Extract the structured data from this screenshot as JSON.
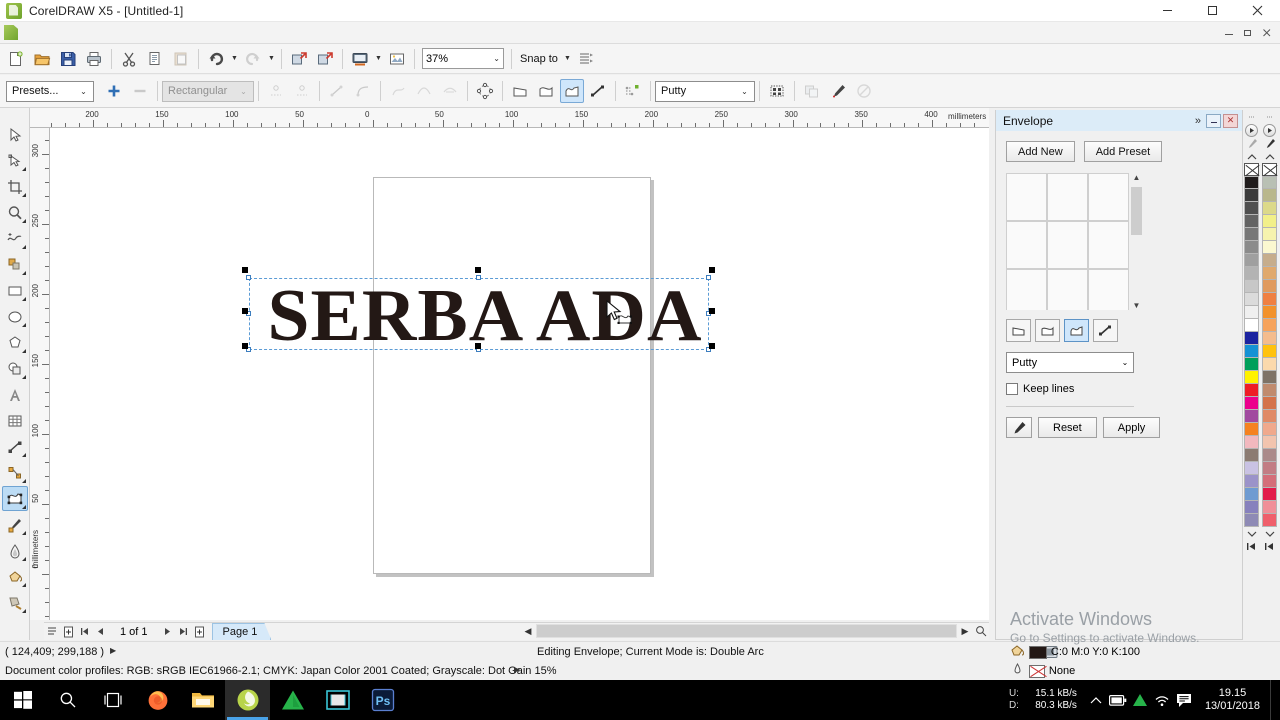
{
  "window": {
    "title": "CorelDRAW X5 - [Untitled-1]",
    "app_icon": "coreldraw-icon",
    "buttons": {
      "minimize": "minimize-icon",
      "maximize": "maximize-icon",
      "close": "close-icon"
    }
  },
  "doc_strip": {
    "icon": "document-icon",
    "buttons": [
      "minimize-icon",
      "restore-icon",
      "close-icon"
    ]
  },
  "toolbar": {
    "items": [
      {
        "name": "new-document-button",
        "icon": "new-icon"
      },
      {
        "name": "open-document-button",
        "icon": "folder-open-icon"
      },
      {
        "name": "save-document-button",
        "icon": "save-icon"
      },
      {
        "name": "print-button",
        "icon": "printer-icon"
      },
      {
        "name": "cut-button",
        "icon": "scissors-icon"
      },
      {
        "name": "copy-button",
        "icon": "copy-icon"
      },
      {
        "name": "paste-button",
        "icon": "paste-icon"
      },
      {
        "name": "undo-button",
        "icon": "undo-icon"
      },
      {
        "name": "redo-button",
        "icon": "redo-icon"
      },
      {
        "name": "import-button",
        "icon": "import-icon"
      },
      {
        "name": "export-button",
        "icon": "export-icon"
      },
      {
        "name": "application-launcher-button",
        "icon": "launcher-icon"
      },
      {
        "name": "corel-connect-button",
        "icon": "connect-icon"
      }
    ],
    "zoom_level": "37%",
    "snap_to_label": "Snap to",
    "options_icon": "options-icon"
  },
  "property_bar": {
    "presets_value": "Presets...",
    "add_preset_icon": "plus-icon",
    "remove_preset_icon": "minus-icon",
    "envelope_mode_value": "Rectangular",
    "mapping_mode_value": "Putty",
    "tools": [
      {
        "name": "add-node-button",
        "icon": "add-node-icon",
        "enabled": false
      },
      {
        "name": "delete-node-button",
        "icon": "delete-node-icon",
        "enabled": false
      },
      {
        "name": "convert-to-line-button",
        "icon": "to-line-icon",
        "enabled": false
      },
      {
        "name": "convert-to-curve-button",
        "icon": "to-curve-icon",
        "enabled": false
      },
      {
        "name": "cusp-node-button",
        "icon": "cusp-node-icon",
        "enabled": false
      },
      {
        "name": "smooth-node-button",
        "icon": "smooth-node-icon",
        "enabled": false
      },
      {
        "name": "symmetrical-node-button",
        "icon": "symmetrical-node-icon",
        "enabled": false
      },
      {
        "name": "envelope-straight-line-mode",
        "icon": "straight-line-envelope-icon",
        "enabled": true
      },
      {
        "name": "envelope-single-arc-mode",
        "icon": "single-arc-envelope-icon",
        "enabled": true
      },
      {
        "name": "envelope-double-arc-mode",
        "icon": "double-arc-envelope-icon",
        "enabled": true,
        "selected": true
      },
      {
        "name": "envelope-unconstrained-mode",
        "icon": "unconstrained-envelope-icon",
        "enabled": true
      },
      {
        "name": "add-new-envelope-button",
        "icon": "add-new-envelope-icon",
        "enabled": true
      },
      {
        "name": "create-envelope-from-button",
        "icon": "create-from-icon",
        "enabled": true
      },
      {
        "name": "keep-lines-button",
        "icon": "keep-lines-icon",
        "enabled": false
      },
      {
        "name": "copy-envelope-properties-button",
        "icon": "eyedropper-icon",
        "enabled": true
      },
      {
        "name": "clear-envelope-button",
        "icon": "clear-envelope-icon",
        "enabled": false
      }
    ]
  },
  "toolbox": {
    "tools": [
      {
        "name": "pick-tool",
        "icon": "arrow-cursor-icon",
        "flyout": false
      },
      {
        "name": "shape-tool",
        "icon": "shape-node-icon",
        "flyout": true
      },
      {
        "name": "crop-tool",
        "icon": "crop-icon",
        "flyout": true
      },
      {
        "name": "zoom-tool",
        "icon": "magnifier-icon",
        "flyout": true
      },
      {
        "name": "freehand-tool",
        "icon": "freehand-curve-icon",
        "flyout": true
      },
      {
        "name": "smart-fill-tool",
        "icon": "smart-fill-icon",
        "flyout": true
      },
      {
        "name": "rectangle-tool",
        "icon": "rectangle-icon",
        "flyout": true
      },
      {
        "name": "ellipse-tool",
        "icon": "ellipse-icon",
        "flyout": true
      },
      {
        "name": "polygon-tool",
        "icon": "polygon-icon",
        "flyout": true
      },
      {
        "name": "basic-shapes-tool",
        "icon": "basic-shapes-icon",
        "flyout": true
      },
      {
        "name": "text-tool",
        "icon": "letter-a-icon",
        "flyout": false
      },
      {
        "name": "table-tool",
        "icon": "table-grid-icon",
        "flyout": false
      },
      {
        "name": "dimension-tool",
        "icon": "dimension-line-icon",
        "flyout": true
      },
      {
        "name": "connector-tool",
        "icon": "connector-icon",
        "flyout": true
      },
      {
        "name": "blend-tool",
        "icon": "distort-envelope-icon",
        "flyout": true,
        "selected": true
      },
      {
        "name": "color-eyedropper-tool",
        "icon": "eyedropper-icon",
        "flyout": true
      },
      {
        "name": "outline-tool",
        "icon": "pen-nib-icon",
        "flyout": true
      },
      {
        "name": "fill-tool",
        "icon": "paint-bucket-icon",
        "flyout": true
      },
      {
        "name": "interactive-fill-tool",
        "icon": "interactive-fill-icon",
        "flyout": true
      }
    ]
  },
  "rulers": {
    "unit_label": "millimeters",
    "h_labels": [
      "200",
      "150",
      "100",
      "50",
      "0",
      "50",
      "100",
      "150",
      "200",
      "250",
      "300",
      "350",
      "400"
    ],
    "v_labels": [
      "300",
      "250",
      "200",
      "150",
      "100",
      "50",
      "0"
    ]
  },
  "canvas": {
    "artwork_text": "SERBA ADA",
    "artwork_color": "#231815",
    "selection_handles": 8,
    "envelope_nodes": 8
  },
  "navbar": {
    "page_indicator": "1 of 1",
    "page_tab": "Page 1",
    "first_icon": "first-page-icon",
    "prev_icon": "previous-page-icon",
    "next_icon": "next-page-icon",
    "last_icon": "last-page-icon",
    "add_page_before_icon": "add-page-before-icon",
    "add_page_after_icon": "add-page-after-icon"
  },
  "status_bar": {
    "coordinates": "( 124,409; 299,188 )",
    "mode_text": "Editing Envelope;  Current Mode is: Double Arc",
    "color_profiles": "Document color profiles: RGB: sRGB IEC61966-2.1; CMYK: Japan Color 2001 Coated; Grayscale: Dot Gain 15%",
    "fill_value": "C:0 M:0 Y:0 K:100",
    "outline_value": "None",
    "fill_icon": "fill-bucket-icon",
    "outline_icon": "outline-pen-icon",
    "snapshot_icon": "snapshot-icon"
  },
  "docker": {
    "title": "Envelope",
    "chevron_icon": "double-chevron-right-icon",
    "minimize_icon": "minimize-icon",
    "close_icon": "close-icon",
    "add_new_label": "Add New",
    "add_preset_label": "Add Preset",
    "preset_cells": 9,
    "mode_buttons": [
      {
        "name": "envelope-straight-line-mode",
        "icon": "straight-line-envelope-icon",
        "selected": false
      },
      {
        "name": "envelope-single-arc-mode",
        "icon": "single-arc-envelope-icon",
        "selected": false
      },
      {
        "name": "envelope-double-arc-mode",
        "icon": "double-arc-envelope-icon",
        "selected": true
      },
      {
        "name": "envelope-unconstrained-mode",
        "icon": "unconstrained-envelope-icon",
        "selected": false
      }
    ],
    "mapping_value": "Putty",
    "keep_lines_label": "Keep lines",
    "keep_lines_checked": false,
    "eyedropper_icon": "eyedropper-icon",
    "reset_label": "Reset",
    "apply_label": "Apply"
  },
  "palette": {
    "no_color_label": "No Color",
    "column1": [
      "#201c1c",
      "#3b3b3b",
      "#4f4f4f",
      "#636363",
      "#777777",
      "#8b8b8b",
      "#9f9f9f",
      "#b3b3b3",
      "#c7c7c7",
      "#dbdbdb",
      "#efefef",
      "#ffffff",
      "#1b23a0",
      "#1592d4",
      "#009f5a",
      "#fff200",
      "#ee1c25",
      "#ec008c",
      "#a1499f",
      "#f58220",
      "#f2b8be",
      "#8c7b72",
      "#c9c2e3",
      "#9b93c9",
      "#6f9bd1",
      "#8781bd",
      "#8e8ab5"
    ],
    "column2": [
      "#b9c0b4",
      "#b9b78c",
      "#dcd98a",
      "#f2f08a",
      "#f6f3ae",
      "#fbf8d0",
      "#c6ad8c",
      "#e0a96d",
      "#e09a5e",
      "#ef8042",
      "#f2922c",
      "#f6a35c",
      "#f4bc8d",
      "#ffc20e",
      "#fbd9ac",
      "#7e7266",
      "#c08b6e",
      "#d4734a",
      "#e08a66",
      "#f0a98c",
      "#f2c4ae",
      "#ab8a8a",
      "#c27d84",
      "#d46e79",
      "#e21b4a",
      "#f08f98",
      "#ef5f6b"
    ]
  },
  "watermark": {
    "line1": "Activate Windows",
    "line2": "Go to Settings to activate Windows."
  },
  "taskbar": {
    "items": [
      {
        "name": "start-button",
        "icon": "windows-logo-icon"
      },
      {
        "name": "search-button",
        "icon": "search-icon"
      },
      {
        "name": "task-view-button",
        "icon": "task-view-icon"
      },
      {
        "name": "firefox-taskbar-button",
        "icon": "firefox-icon"
      },
      {
        "name": "file-explorer-taskbar-button",
        "icon": "folder-icon"
      },
      {
        "name": "coreldraw-taskbar-button",
        "icon": "coreldraw-icon",
        "active": true
      },
      {
        "name": "affinity-taskbar-button",
        "icon": "green-triangle-icon"
      },
      {
        "name": "video-editor-taskbar-button",
        "icon": "film-strip-icon"
      },
      {
        "name": "photoshop-taskbar-button",
        "icon": "photoshop-icon"
      }
    ],
    "upload_key": "U:",
    "upload_value": "15.1 kB/s",
    "download_key": "D:",
    "download_value": "80.3 kB/s",
    "tray_icons": [
      "chevron-up-icon",
      "battery-icon",
      "green-triangle-icon",
      "wifi-icon",
      "action-center-icon"
    ],
    "time": "19.15",
    "date": "13/01/2018"
  }
}
